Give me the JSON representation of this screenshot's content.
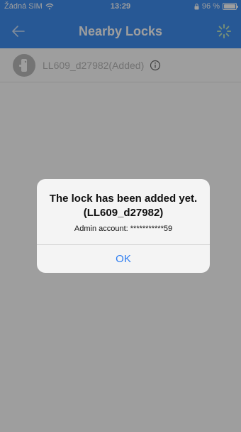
{
  "status_bar": {
    "carrier": "Žádná SIM",
    "time": "13:29",
    "battery": "96 %"
  },
  "nav": {
    "title": "Nearby Locks"
  },
  "locks": [
    {
      "name": "LL609_d27982(Added)"
    }
  ],
  "alert": {
    "title_line1": "The lock has been added yet.",
    "title_line2": "(LL609_d27982)",
    "detail": "Admin account: ***********59",
    "ok_label": "OK"
  },
  "colors": {
    "accent": "#3f8ef0",
    "ok_button": "#2f7ef1",
    "disabled_text": "#b8b8b8"
  },
  "icons": {
    "back": "arrow-left-icon",
    "refresh": "loading-spinner-icon",
    "lock": "door-lock-icon",
    "info": "info-circle-icon",
    "wifi": "wifi-icon",
    "battery": "battery-icon"
  }
}
